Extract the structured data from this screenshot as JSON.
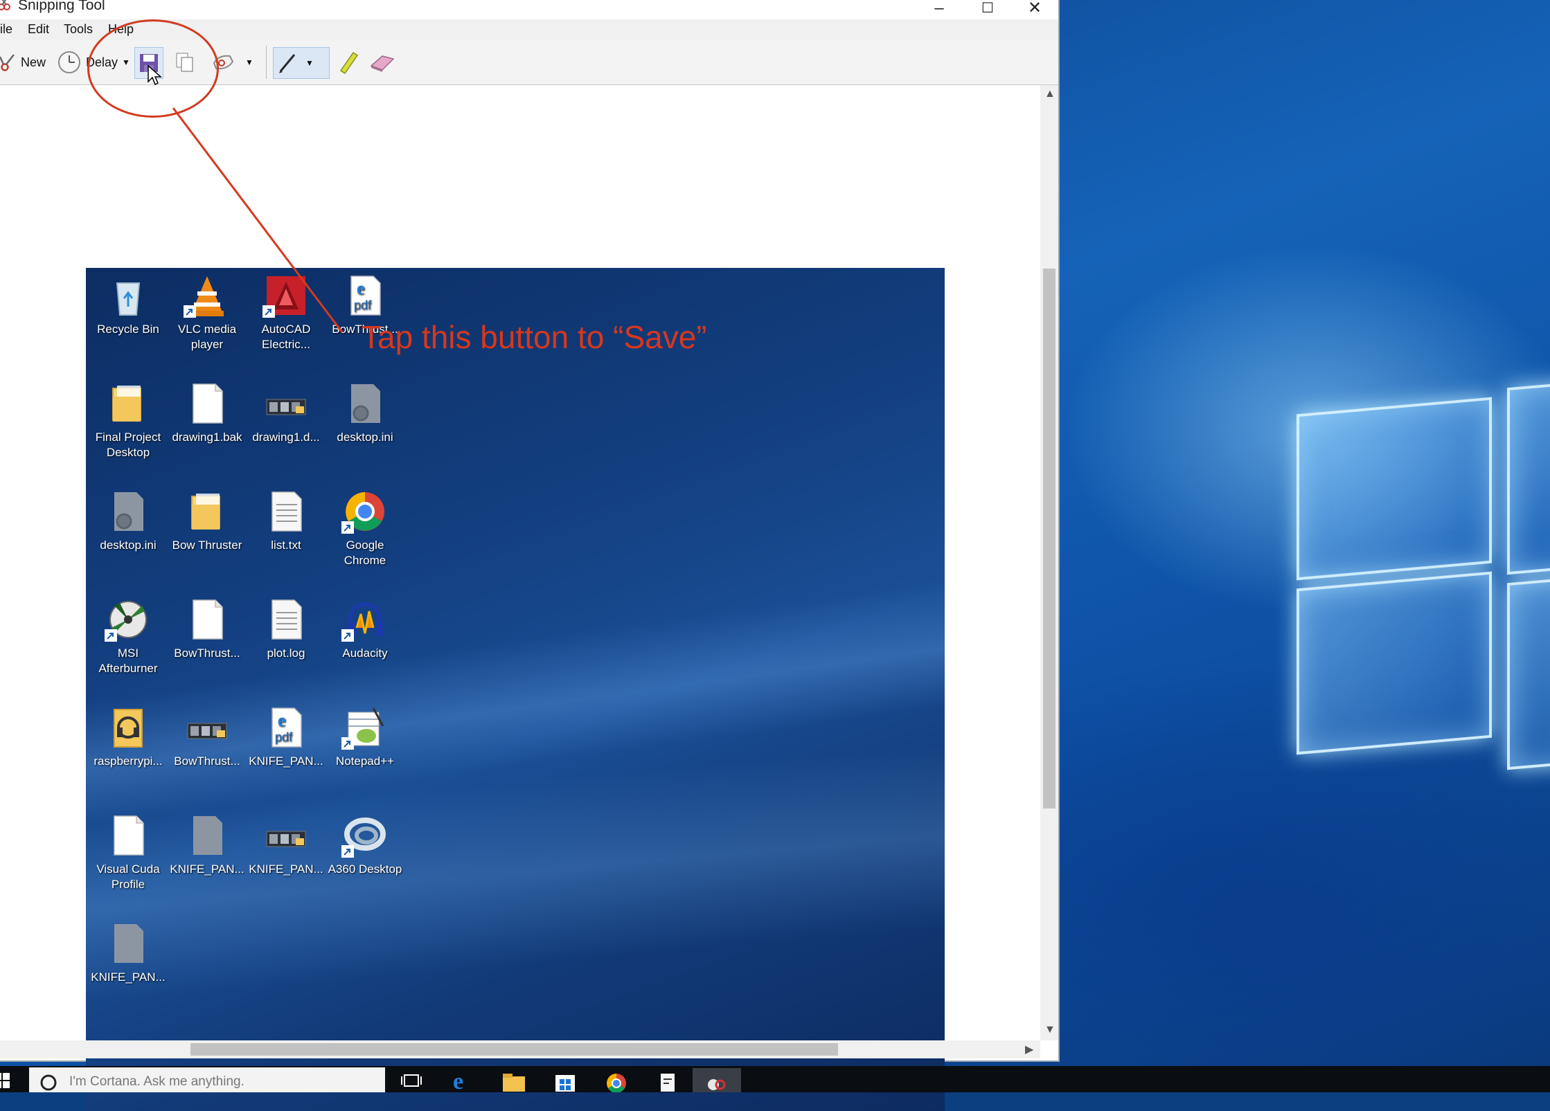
{
  "window": {
    "title": "Snipping Tool",
    "minimize_glyph": "–",
    "maximize_glyph": "☐",
    "close_glyph": "✕"
  },
  "menu": {
    "file": "ile",
    "edit": "Edit",
    "tools": "Tools",
    "help": "Help"
  },
  "toolbar": {
    "new_label": "New",
    "delay_label": "Delay"
  },
  "icons": {
    "new": "scissors-icon",
    "delay": "clock-icon",
    "save": "save-disk-icon",
    "copy": "copy-icon",
    "send": "send-snip-icon",
    "pen": "pen-icon",
    "highlighter": "highlighter-icon",
    "eraser": "eraser-icon"
  },
  "desktop_icons": [
    {
      "label": "Recycle Bin",
      "icon": "recycle-bin-icon"
    },
    {
      "label": "VLC media player",
      "icon": "vlc-icon"
    },
    {
      "label": "AutoCAD Electric...",
      "icon": "autocad-icon"
    },
    {
      "label": "BowThrust...",
      "icon": "pdf-icon"
    },
    {
      "label": "Final Project Desktop",
      "icon": "folder-icon"
    },
    {
      "label": "drawing1.bak",
      "icon": "file-icon"
    },
    {
      "label": "drawing1.d...",
      "icon": "image-file-icon"
    },
    {
      "label": "desktop.ini",
      "icon": "settings-file-icon"
    },
    {
      "label": "desktop.ini",
      "icon": "settings-file-icon"
    },
    {
      "label": "Bow Thruster",
      "icon": "folder-icon"
    },
    {
      "label": "list.txt",
      "icon": "text-file-icon"
    },
    {
      "label": "Google Chrome",
      "icon": "chrome-icon"
    },
    {
      "label": "MSI Afterburner",
      "icon": "msi-afterburner-icon"
    },
    {
      "label": "BowThrust...",
      "icon": "file-icon"
    },
    {
      "label": "plot.log",
      "icon": "text-file-icon"
    },
    {
      "label": "Audacity",
      "icon": "audacity-icon"
    },
    {
      "label": "raspberrypi...",
      "icon": "audio-folder-icon"
    },
    {
      "label": "BowThrust...",
      "icon": "image-file-icon"
    },
    {
      "label": "KNIFE_PAN...",
      "icon": "pdf-icon"
    },
    {
      "label": "Notepad++",
      "icon": "notepadpp-icon"
    },
    {
      "label": "Visual Cuda Profile",
      "icon": "file-icon"
    },
    {
      "label": "KNIFE_PAN...",
      "icon": "gray-file-icon"
    },
    {
      "label": "KNIFE_PAN...",
      "icon": "image-file-icon"
    },
    {
      "label": "A360 Desktop",
      "icon": "a360-icon"
    },
    {
      "label": "KNIFE_PAN...",
      "icon": "gray-file-icon"
    }
  ],
  "annotation": {
    "text": "Tap this button to “Save”",
    "color": "#d8371d"
  },
  "taskbar": {
    "search_placeholder": "I'm Cortana. Ask me anything.",
    "apps": [
      "task-view-icon",
      "edge-icon",
      "file-explorer-icon",
      "store-icon",
      "chrome-icon",
      "notepad-icon",
      "snipping-tool-icon"
    ]
  },
  "colors": {
    "accent_blue": "#1563b8",
    "annotation_red": "#d8371d",
    "taskbar": "#0a0d12"
  }
}
